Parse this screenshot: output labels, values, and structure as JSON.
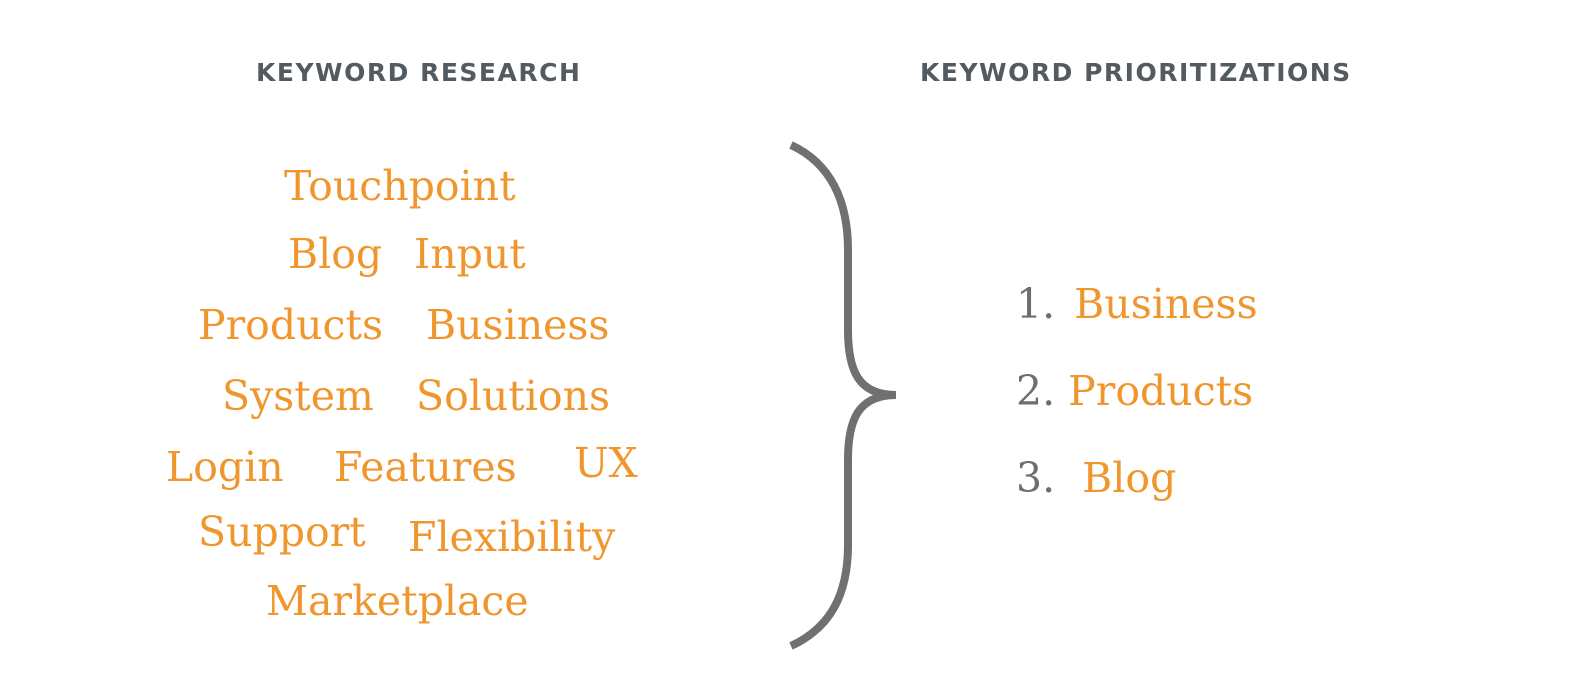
{
  "headings": {
    "research": "KEYWORD RESEARCH",
    "prioritizations": "KEYWORD PRIORITIZATIONS"
  },
  "colors": {
    "heading": "#545b60",
    "keyword": "#f0962e",
    "number": "#6e6e6e",
    "brace": "#707070"
  },
  "research_keywords": [
    "Touchpoint",
    "Blog",
    "Input",
    "Products",
    "Business",
    "System",
    "Solutions",
    "Login",
    "Features",
    "UX",
    "Support",
    "Flexibility",
    "Marketplace"
  ],
  "prioritized": [
    {
      "number": "1.",
      "keyword": "Business"
    },
    {
      "number": "2.",
      "keyword": "Products"
    },
    {
      "number": "3.",
      "keyword": "Blog"
    }
  ],
  "connector_icon": "curly-brace-right"
}
